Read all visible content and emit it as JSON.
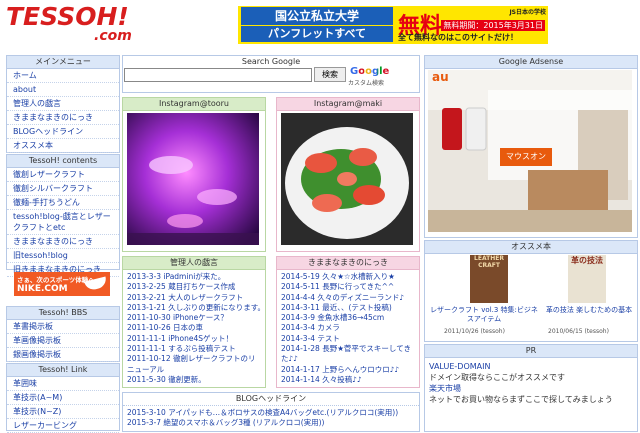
{
  "header": {
    "logo_main": "TESSOH!",
    "logo_dotcom": ".com",
    "banner": {
      "line1": "国公立私立大学",
      "line2": "パンフレットすべて",
      "big": "無料",
      "deadline": "無料期間：2015年3月31日",
      "brand": "JS日本の学校",
      "free_line": "全て無料なのはこのサイトだけ！"
    }
  },
  "left": {
    "main_menu": {
      "title": "メインメニュー",
      "items": [
        "ホーム",
        "about",
        "管理人の戯言",
        "きままなまきのにっき",
        "BLOGヘッドライン",
        "オススメ本"
      ]
    },
    "tessoh_contents": {
      "title": "TessoH! contents",
      "items": [
        "徹創レザークラフト",
        "徹創シルバークラフト",
        "徹麺-手打ちうどん",
        "tessoh!blog-戯言とレザークラフトとetc",
        "きままなまきのにっき",
        "旧tessoh!blog",
        "旧きままなまきのにっき"
      ]
    },
    "nike": {
      "line1": "さぁ、次のスポーツ体験へ",
      "line2": "NIKE.COM"
    },
    "bbs": {
      "title": "Tessoh! BBS",
      "items": [
        "革書掲示板",
        "革画像掲示板",
        "銀画像掲示板"
      ]
    },
    "link": {
      "title": "Tessoh! Link",
      "items": [
        "革囲味",
        "革技示(A~M)",
        "革技示(N~Z)",
        "レザーカービング"
      ]
    }
  },
  "center": {
    "search": {
      "title": "Search Google",
      "button": "検索",
      "google": "Google",
      "google_sub": "カスタム検索"
    },
    "insta1": {
      "title": "Instagram@tooru"
    },
    "insta2": {
      "title": "Instagram@maki"
    },
    "kanrinin": {
      "title": "管理人の戯言",
      "posts": [
        "2013-3-3 iPadminiが来た。",
        "2013-2-25 蔵目打ちケース作成",
        "2013-2-21 大人のレザークラフト",
        "2013-1-21 久しぶりの更新になります。",
        "2011-10-30 iPhoneケース？",
        "2011-10-26 日本の車",
        "2011-11-1 iPhone4Sゲット！",
        "2011-11-1 するぷら投稿テスト",
        "2011-10-12 徹創レザークラフトのリニューアル",
        "2011-5-30 徹創更新。"
      ]
    },
    "kimama": {
      "title": "きままなまきのにっき",
      "posts": [
        "2014-5-19 久々★☆水槽新入り★",
        "2014-5-11 長野に行ってきた^^",
        "2014-4-4 久々のディズニーランド♪",
        "2014-3-11 最近、、(テスト投稿)",
        "2014-3-9 金魚水槽36→45cm",
        "2014-3-4 カメラ",
        "2014-3-4 テスト",
        "2014-1-28 長野★菅平でスキーしてきた♪♪",
        "2014-1-17 上野らへんウロウロ♪♪",
        "2014-1-14 久々投稿♪♪"
      ]
    },
    "blog_headline": {
      "title": "BLOGヘッドライン",
      "posts": [
        "2015-3-10 アイパッドも…＆ボロサスの検査A4バッグetc.(リアルクロコ(実用))",
        "2015-3-7 絶望のスマホ＆バッグ3種 (リアルクロコ(実用))"
      ]
    }
  },
  "right": {
    "adsense": {
      "title": "Google Adsense",
      "brand": "au",
      "button": "マウスオン"
    },
    "books": {
      "title": "オススメ本",
      "items": [
        {
          "caption": "レザークラフト vol.3 特集:ビジネスアイテム",
          "meta": "2011/10/26 (tessoh)"
        },
        {
          "caption": "革の技法 楽しむための基本",
          "meta": "2010/06/15 (tessoh)"
        }
      ],
      "book1_cover": "LEATHER CRAFT",
      "book2_cover": "革の技法"
    },
    "pr": {
      "title": "PR",
      "items": [
        "VALUE-DOMAIN",
        "ドメイン取得ならここがオススメです",
        "楽天市場",
        "ネットでお買い物ならまずここで探してみましょう"
      ]
    }
  }
}
